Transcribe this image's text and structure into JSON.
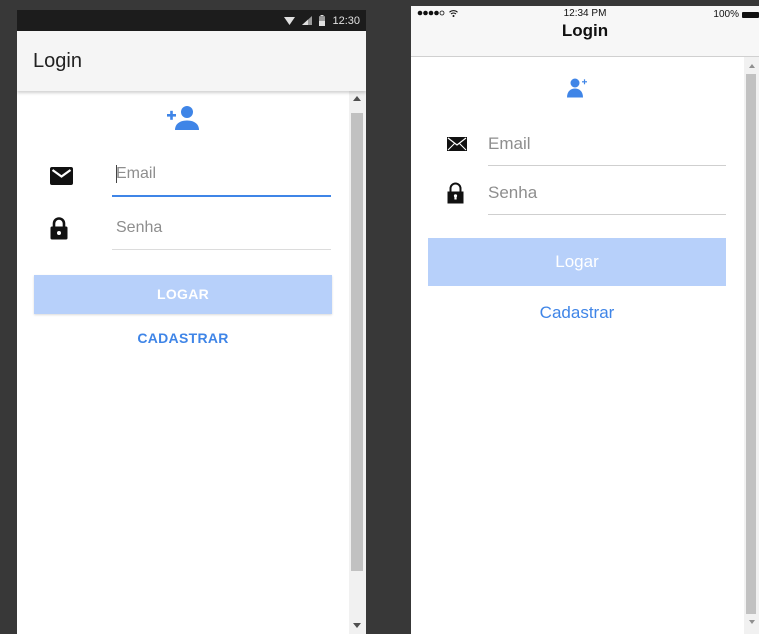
{
  "android": {
    "status_time": "12:30",
    "title": "Login",
    "email_placeholder": "Email",
    "senha_placeholder": "Senha",
    "login_button": "LOGAR",
    "register_button": "CADASTRAR"
  },
  "ios": {
    "status_time": "12:34 PM",
    "battery": "100%",
    "title": "Login",
    "email_placeholder": "Email",
    "senha_placeholder": "Senha",
    "login_button": "Logar",
    "register_button": "Cadastrar"
  },
  "icons": {
    "add_user": "person-add-icon",
    "email": "envelope-icon",
    "password": "lock-icon"
  },
  "colors": {
    "accent": "#3f85e7",
    "button_disabled": "#b7d0fa"
  }
}
